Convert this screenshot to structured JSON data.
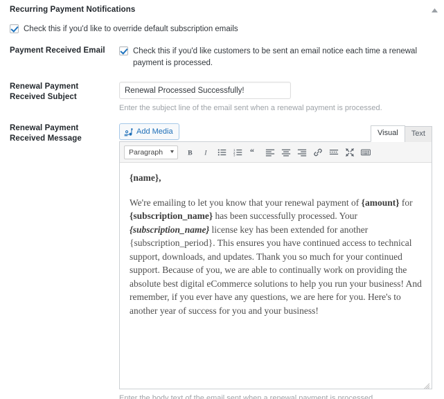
{
  "section": {
    "title": "Recurring Payment Notifications",
    "scroll_icon": "caret-up-icon"
  },
  "override_row": {
    "checkbox_label": "Check this if you'd like to override default subscription emails",
    "checked": true
  },
  "payment_received_email_row": {
    "label": "Payment Received Email",
    "checkbox_label": "Check this if you'd like customers to be sent an email notice each time a renewal payment is processed.",
    "checked": true
  },
  "subject_row": {
    "label": "Renewal Payment Received Subject",
    "value": "Renewal Processed Successfully!",
    "placeholder": "",
    "help": "Enter the subject line of the email sent when a renewal payment is processed."
  },
  "message_row": {
    "label": "Renewal Payment Received Message",
    "help": "Enter the body text of the email sent when a renewal payment is processed.",
    "editor": {
      "add_media_label": "Add Media",
      "add_media_icon": "media-icon",
      "tabs": [
        {
          "label": "Visual",
          "active": true
        },
        {
          "label": "Text",
          "active": false
        }
      ],
      "format_select": "Paragraph",
      "toolbar_buttons": [
        "bold-icon",
        "italic-icon",
        "bulleted-list-icon",
        "numbered-list-icon",
        "blockquote-icon",
        "align-left-icon",
        "align-center-icon",
        "align-right-icon",
        "link-icon",
        "insert-read-more-icon",
        "fullscreen-icon",
        "keyboard-shortcuts-icon"
      ],
      "body": {
        "greeting": "{name},",
        "paragraph_parts": [
          {
            "text": "We're emailing to let you know that your renewal payment of ",
            "style": "normal"
          },
          {
            "text": "{amount}",
            "style": "bold"
          },
          {
            "text": " for ",
            "style": "normal"
          },
          {
            "text": "{subscription_name}",
            "style": "bold"
          },
          {
            "text": " has been successfully processed. Your ",
            "style": "normal"
          },
          {
            "text": "{subscription_name}",
            "style": "bold-italic"
          },
          {
            "text": " license key has been extended for another {subscription_period}. This ensures you have continued access to technical support, downloads, and updates. Thank you so much for your continued support. Because of you, we are able to continually work on providing the absolute best digital eCommerce solutions to help you run your business! And remember, if you ever have any questions, we are here for you. Here's to another year of success for you and your business!",
            "style": "normal"
          }
        ]
      },
      "resize_handle": "resize-grip-icon"
    }
  },
  "colors": {
    "accent_blue": "#1e73be",
    "label_text": "#23282d",
    "help_text": "#9ea3a8",
    "border": "#ccd0d4"
  }
}
